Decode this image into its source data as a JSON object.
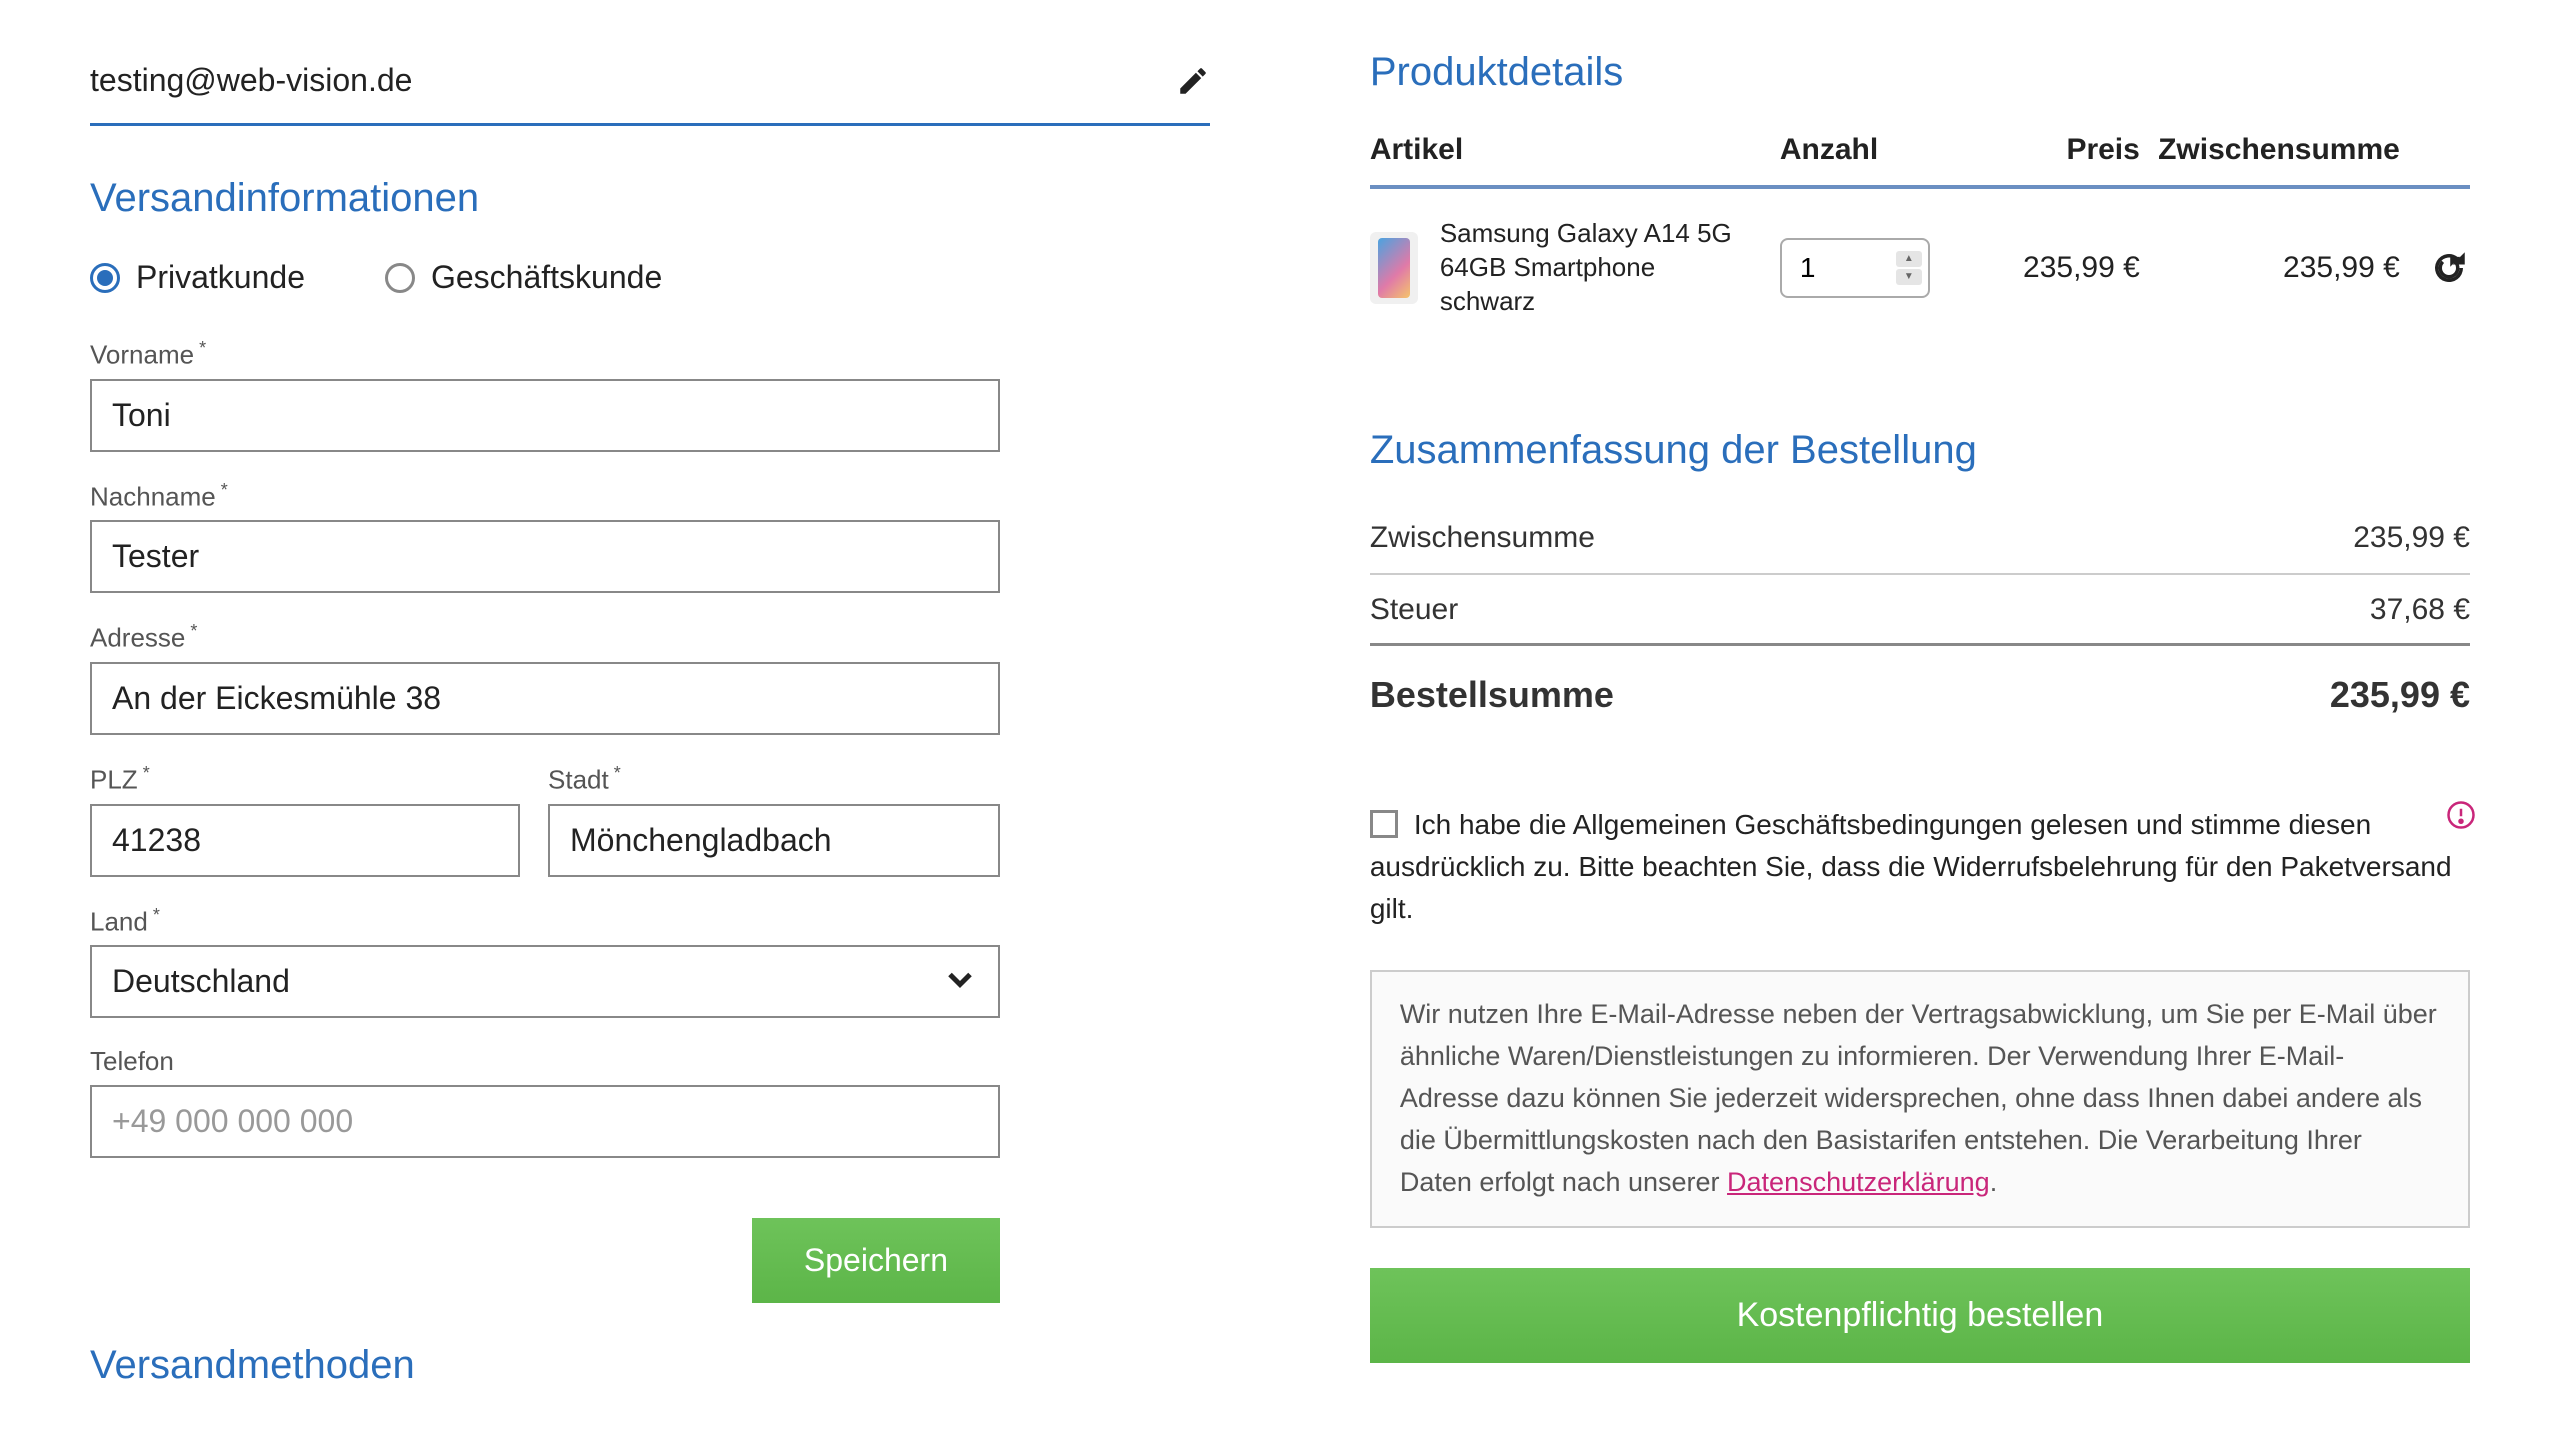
{
  "email": "testing@web-vision.de",
  "sections": {
    "shipping_info_title": "Versandinformationen",
    "shipping_methods_title": "Versandmethoden",
    "product_details_title": "Produktdetails",
    "order_summary_title": "Zusammenfassung der Bestellung"
  },
  "customer_type": {
    "private_label": "Privatkunde",
    "business_label": "Geschäftskunde",
    "selected": "private"
  },
  "form": {
    "firstname_label": "Vorname",
    "firstname_value": "Toni",
    "lastname_label": "Nachname",
    "lastname_value": "Tester",
    "address_label": "Adresse",
    "address_value": "An der Eickesmühle 38",
    "zip_label": "PLZ",
    "zip_value": "41238",
    "city_label": "Stadt",
    "city_value": "Mönchengladbach",
    "country_label": "Land",
    "country_value": "Deutschland",
    "phone_label": "Telefon",
    "phone_placeholder": "+49 000 000 000",
    "phone_value": "",
    "save_button": "Speichern"
  },
  "table_headers": {
    "article": "Artikel",
    "qty": "Anzahl",
    "price": "Preis",
    "subtotal": "Zwischensumme"
  },
  "cart": [
    {
      "name": "Samsung Galaxy A14 5G 64GB Smartphone schwarz",
      "qty": "1",
      "price": "235,99 €",
      "subtotal": "235,99 €"
    }
  ],
  "summary": {
    "subtotal_label": "Zwischensumme",
    "subtotal_value": "235,99 €",
    "tax_label": "Steuer",
    "tax_value": "37,68 €",
    "total_label": "Bestellsumme",
    "total_value": "235,99 €"
  },
  "agb_text": "Ich habe die Allgemeinen Geschäftsbedingungen gelesen und stimme diesen ausdrücklich zu. Bitte beachten Sie, dass die Widerrufsbelehrung für den Paketversand gilt.",
  "info_text_pre": "Wir nutzen Ihre E-Mail-Adresse neben der Vertragsabwicklung, um Sie per E-Mail über ähnliche Waren/Dienstleistungen zu informieren. Der Verwendung Ihrer E-Mail-Adresse dazu können Sie jederzeit widersprechen, ohne dass Ihnen dabei andere als die Übermittlungskosten nach den Basistarifen entstehen. Die Verarbeitung Ihrer Daten erfolgt nach unserer ",
  "info_link": "Datenschutzerklärung",
  "info_text_post": ".",
  "order_button": "Kostenpflichtig bestellen"
}
